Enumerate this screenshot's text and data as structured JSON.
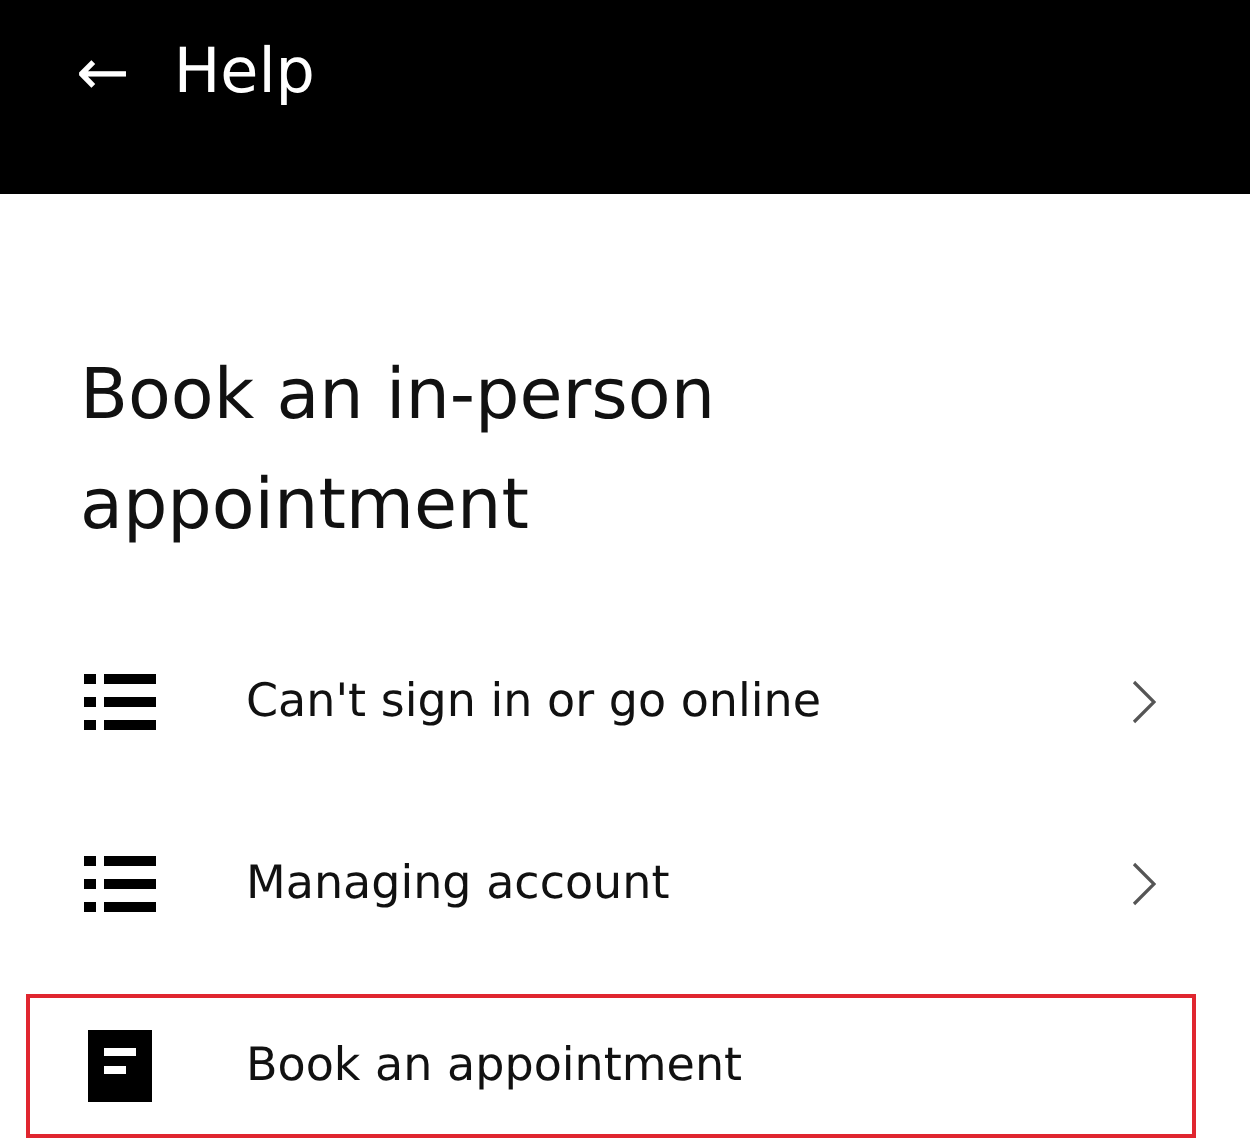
{
  "header": {
    "back_icon": "←",
    "title": "Help"
  },
  "heading": "Book an in-person appointment",
  "items": [
    {
      "kind": "list",
      "label": "Can't sign in or go online",
      "chevron": true,
      "highlighted": false
    },
    {
      "kind": "list",
      "label": "Managing account",
      "chevron": true,
      "highlighted": false
    },
    {
      "kind": "document",
      "label": "Book an appointment",
      "chevron": false,
      "highlighted": true
    }
  ]
}
